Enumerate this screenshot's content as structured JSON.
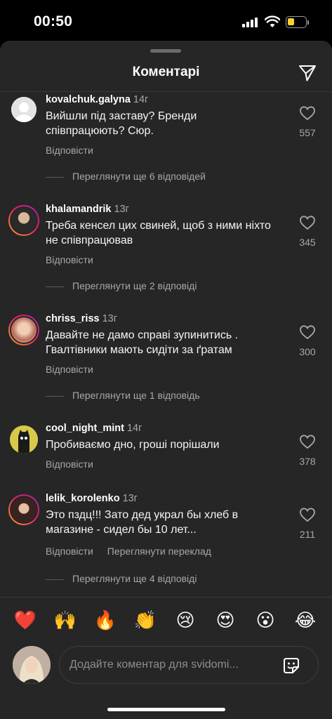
{
  "status_bar": {
    "time": "00:50"
  },
  "header": {
    "title": "Коментарі"
  },
  "comments": [
    {
      "username": "kovalchuk.galyna",
      "time": "14г",
      "text": "Вийшли під заставу? Бренди співпрацюють? Сюр.",
      "likes": "557",
      "reply_label": "Відповісти",
      "view_replies": "Переглянути ще 6 відповідей"
    },
    {
      "username": "khalamandrik",
      "time": "13г",
      "text": "Треба кенсел цих свиней, щоб з ними ніхто не співпрацював",
      "likes": "345",
      "reply_label": "Відповісти",
      "view_replies": "Переглянути ще 2 відповіді"
    },
    {
      "username": "chriss_riss",
      "time": "13г",
      "text": "Давайте не дамо справі зупинитись . Гвалтівники мають сидіти за ґратам",
      "likes": "300",
      "reply_label": "Відповісти",
      "view_replies": "Переглянути ще 1 відповідь"
    },
    {
      "username": "cool_night_mint",
      "time": "14г",
      "text": "Пробиваємо дно, гроші порішали",
      "likes": "378",
      "reply_label": "Відповісти"
    },
    {
      "username": "lelik_korolenko",
      "time": "13г",
      "text": "Это пздц!!! Зато дед украл бы хлеб в магазине - сидел бы 10 лет...",
      "likes": "211",
      "reply_label": "Відповісти",
      "translate_label": "Переглянути переклад",
      "view_replies": "Переглянути ще 4 відповіді"
    }
  ],
  "emoji_reactions": [
    "❤️",
    "🙌",
    "🔥",
    "👏",
    "😢",
    "😍",
    "😮",
    "😂"
  ],
  "composer": {
    "placeholder": "Додайте коментар для svidomi..."
  },
  "colors": {
    "sheet_bg": "#262626",
    "text": "#f5f5f5",
    "muted": "#a8a8a8",
    "battery": "#f6d130"
  }
}
